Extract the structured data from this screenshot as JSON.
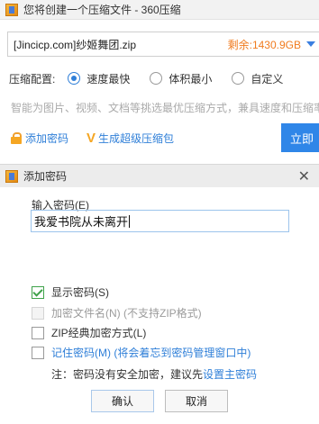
{
  "window": {
    "title": "您将创建一个压缩文件 - 360压缩"
  },
  "path": {
    "value": "[Jincicp.com]纱姬舞团.zip",
    "free_space": "剩余:1430.9GB"
  },
  "config": {
    "label": "压缩配置:",
    "options": [
      {
        "label": "速度最快",
        "selected": true
      },
      {
        "label": "体积最小",
        "selected": false
      },
      {
        "label": "自定义",
        "selected": false
      }
    ]
  },
  "hint": "智能为图片、视频、文档等挑选最优压缩方式，兼具速度和压缩率",
  "actions": {
    "add_password": "添加密码",
    "super_zip": "生成超级压缩包",
    "now_button": "立即"
  },
  "dialog": {
    "title": "添加密码",
    "input_label": "输入密码(E)",
    "password_value": "我爱书院从未离开",
    "checkboxes": [
      {
        "label": "显示密码(S)",
        "checked": true,
        "disabled": false,
        "link": false
      },
      {
        "label": "加密文件名(N) (不支持ZIP格式)",
        "checked": false,
        "disabled": true,
        "link": false
      },
      {
        "label": "ZIP经典加密方式(L)",
        "checked": false,
        "disabled": false,
        "link": false
      },
      {
        "label": "记住密码(M) (将会着忘到密码管理窗口中)",
        "checked": false,
        "disabled": false,
        "link": true
      }
    ],
    "note_prefix": "注：密码没有安全加密，建议先",
    "note_link": "设置主密码",
    "ok_button": "确认",
    "cancel_button": "取消"
  },
  "colors": {
    "accent": "#2f7fd8",
    "orange": "#f07b1e",
    "check_green": "#3fa24a"
  }
}
